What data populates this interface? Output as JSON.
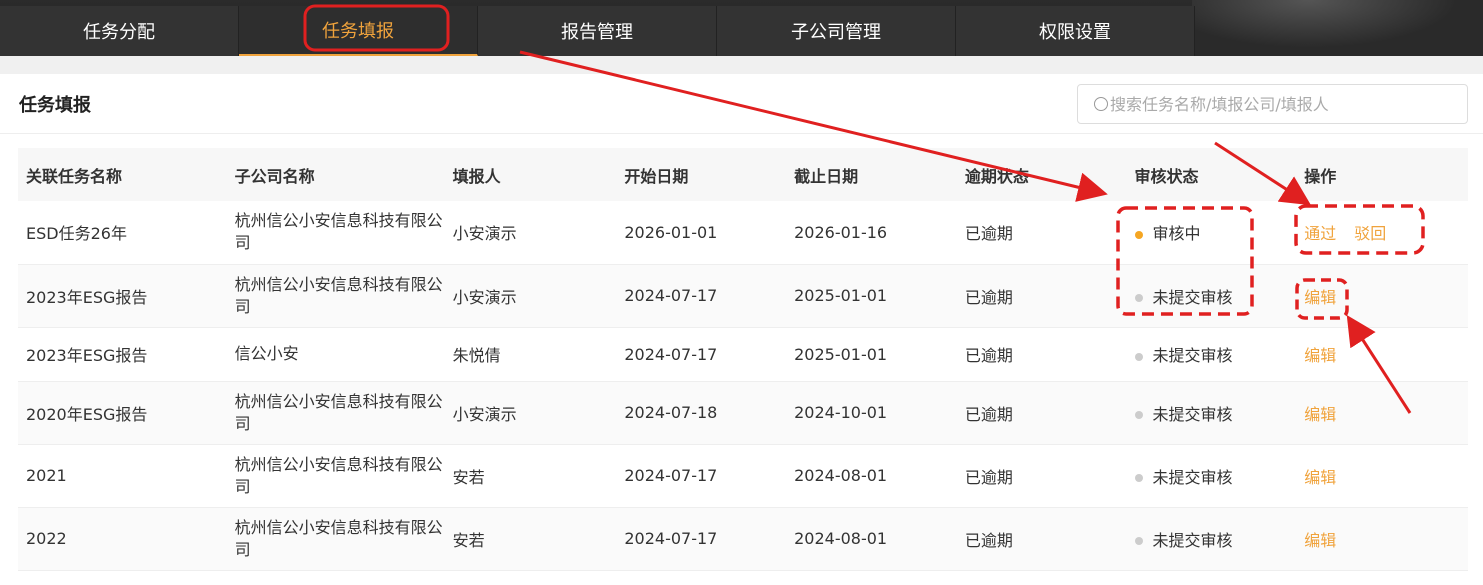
{
  "nav": {
    "tabs": [
      {
        "label": "任务分配"
      },
      {
        "label": "任务填报"
      },
      {
        "label": "报告管理"
      },
      {
        "label": "子公司管理"
      },
      {
        "label": "权限设置"
      }
    ]
  },
  "page": {
    "title": "任务填报",
    "search_placeholder": "搜索任务名称/填报公司/填报人"
  },
  "table": {
    "headers": [
      "关联任务名称",
      "子公司名称",
      "填报人",
      "开始日期",
      "截止日期",
      "逾期状态",
      "审核状态",
      "操作"
    ],
    "rows": [
      {
        "task": "ESD任务26年",
        "company": "杭州信公小安信息科技有限公司",
        "reporter": "小安演示",
        "start": "2026-01-01",
        "end": "2026-01-16",
        "overdue": "已逾期",
        "review": "审核中",
        "actions": [
          "通过",
          "驳回"
        ]
      },
      {
        "task": "2023年ESG报告",
        "company": "杭州信公小安信息科技有限公司",
        "reporter": "小安演示",
        "start": "2024-07-17",
        "end": "2025-01-01",
        "overdue": "已逾期",
        "review": "未提交审核",
        "actions": [
          "编辑"
        ]
      },
      {
        "task": "2023年ESG报告",
        "company": "信公小安",
        "reporter": "朱悦倩",
        "start": "2024-07-17",
        "end": "2025-01-01",
        "overdue": "已逾期",
        "review": "未提交审核",
        "actions": [
          "编辑"
        ]
      },
      {
        "task": "2020年ESG报告",
        "company": "杭州信公小安信息科技有限公司",
        "reporter": "小安演示",
        "start": "2024-07-18",
        "end": "2024-10-01",
        "overdue": "已逾期",
        "review": "未提交审核",
        "actions": [
          "编辑"
        ]
      },
      {
        "task": "2021",
        "company": "杭州信公小安信息科技有限公司",
        "reporter": "安若",
        "start": "2024-07-17",
        "end": "2024-08-01",
        "overdue": "已逾期",
        "review": "未提交审核",
        "actions": [
          "编辑"
        ]
      },
      {
        "task": "2022",
        "company": "杭州信公小安信息科技有限公司",
        "reporter": "安若",
        "start": "2024-07-17",
        "end": "2024-08-01",
        "overdue": "已逾期",
        "review": "未提交审核",
        "actions": [
          "编辑"
        ]
      }
    ]
  },
  "colors": {
    "accent": "#f0a33c",
    "reviewing_dot": "#f5a623",
    "not_submitted_dot": "#cccccc",
    "annotation": "#e02020"
  }
}
